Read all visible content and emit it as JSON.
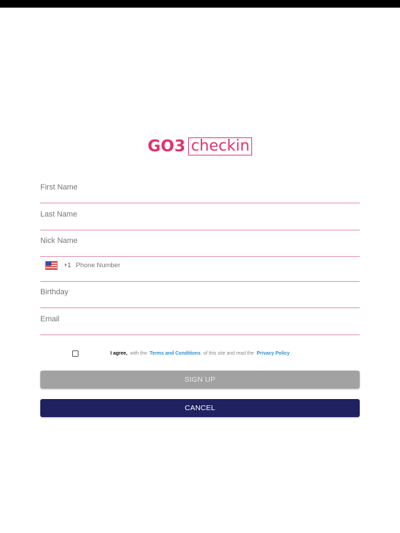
{
  "colors": {
    "brand": "#e0336e",
    "field_underline": "#e58fa8",
    "link": "#2f8fce",
    "signup_disabled": "#a2a2a2",
    "cancel_navy": "#1f2161"
  },
  "logo": {
    "prefix": "GO3",
    "boxed": "checkin"
  },
  "form": {
    "first_name": {
      "placeholder": "First Name",
      "value": ""
    },
    "last_name": {
      "placeholder": "Last Name",
      "value": ""
    },
    "nick_name": {
      "placeholder": "Nick Name",
      "value": ""
    },
    "phone": {
      "flag_icon": "us-flag-icon",
      "country_code": "+1",
      "placeholder": "Phone Number",
      "value": ""
    },
    "birthday": {
      "placeholder": "Birthday",
      "value": ""
    },
    "email": {
      "placeholder": "Email",
      "value": ""
    }
  },
  "agreement": {
    "checked": false,
    "agree_label": "I agree,",
    "with_the": "with the",
    "terms_link": "Terms and Conditions",
    "of_this_site": "of this site and read the",
    "privacy_link": "Privacy Policy"
  },
  "buttons": {
    "signup_label": "SIGN UP",
    "cancel_label": "CANCEL"
  }
}
